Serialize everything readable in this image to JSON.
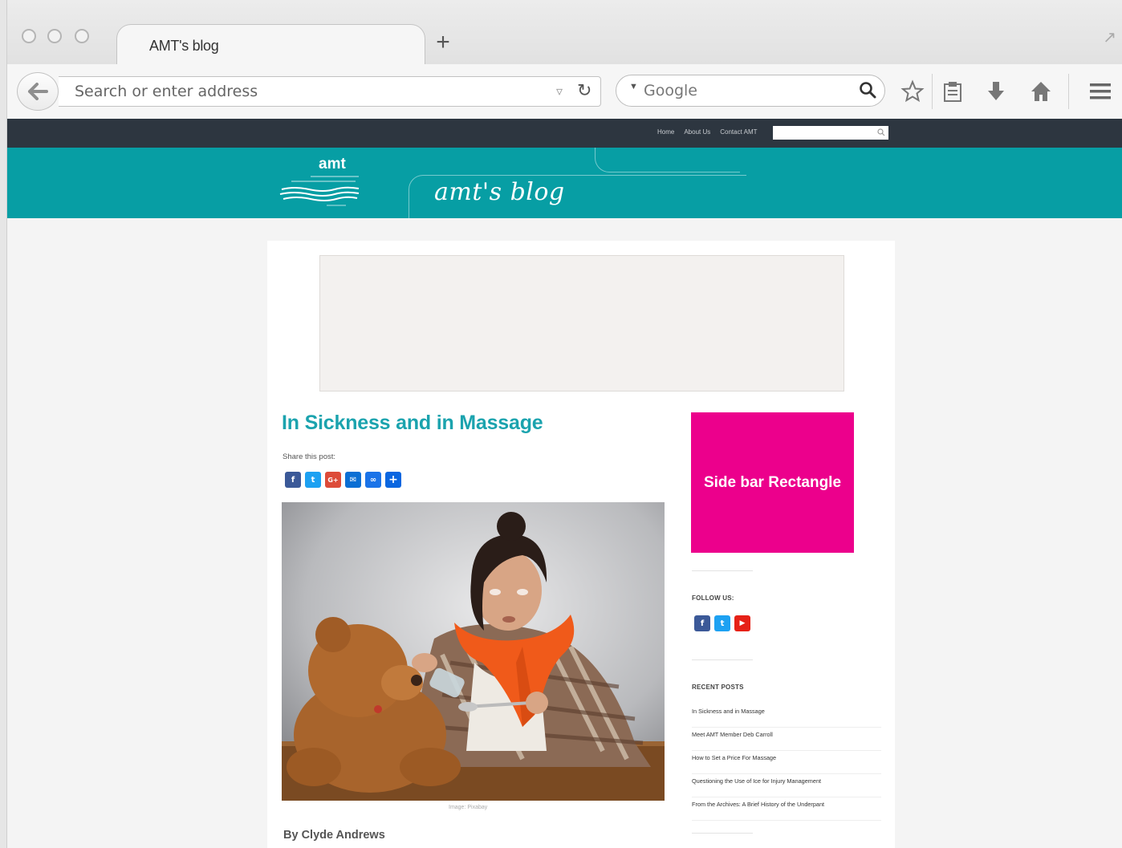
{
  "browser": {
    "tab_title": "AMT's blog",
    "new_tab_symbol": "+",
    "address_placeholder": "Search or enter address",
    "search_engine": "Google"
  },
  "site": {
    "top_nav": [
      "Home",
      "About Us",
      "Contact AMT"
    ],
    "logo_text": "amt",
    "blog_title": "amt's blog",
    "brand_color": "#079ea4",
    "topbar_color": "#2d3640"
  },
  "post": {
    "title": "In Sickness and in Massage",
    "share_label": "Share this post:",
    "share_icons": [
      "facebook-icon",
      "twitter-icon",
      "google-plus-icon",
      "email-icon",
      "link-icon",
      "more-share-icon"
    ],
    "image_caption": "Image: Pixabay",
    "byline": "By Clyde Andrews"
  },
  "sidebar": {
    "rect_label": "Side bar Rectangle",
    "rect_color": "#ec008c",
    "follow_heading": "FOLLOW US:",
    "follow_icons": [
      "facebook-icon",
      "twitter-icon",
      "youtube-icon"
    ],
    "recent_heading": "RECENT POSTS",
    "recent_posts": [
      "In Sickness and in Massage",
      "Meet AMT Member Deb Carroll",
      "How to Set a Price For Massage",
      "Questioning the Use of Ice for Injury Management",
      "From the Archives: A Brief History of the Underpant"
    ]
  }
}
